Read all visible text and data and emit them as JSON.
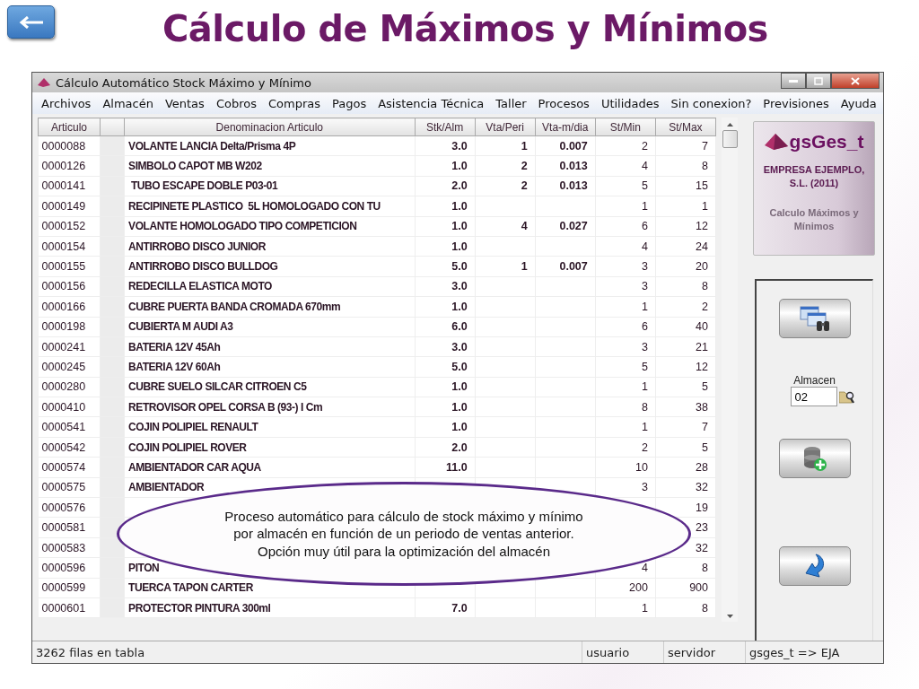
{
  "slide": {
    "title": "Cálculo de Máximos y Mínimos"
  },
  "window": {
    "title": "Cálculo Automático Stock Máximo y Mínimo",
    "menu": [
      "Archivos",
      "Almacén",
      "Ventas",
      "Cobros",
      "Compras",
      "Pagos",
      "Asistencia Técnica",
      "Taller",
      "Procesos",
      "Utilidades",
      "Sin conexion?",
      "Previsiones",
      "Ayuda"
    ],
    "table": {
      "columns": [
        "Articulo",
        "Denominacion Articulo",
        "Stk/Alm",
        "Vta/Peri",
        "Vta-m/dia",
        "St/Min",
        "St/Max"
      ],
      "rows": [
        {
          "articulo": "0000088",
          "denominacion": "VOLANTE LANCIA Delta/Prisma 4P",
          "stk_alm": "3.0",
          "vta_peri": "1",
          "vta_m_dia": "0.007",
          "st_min": "2",
          "st_max": "7"
        },
        {
          "articulo": "0000126",
          "denominacion": "SIMBOLO CAPOT MB W202",
          "stk_alm": "1.0",
          "vta_peri": "2",
          "vta_m_dia": "0.013",
          "st_min": "4",
          "st_max": "8"
        },
        {
          "articulo": "0000141",
          "denominacion": " TUBO ESCAPE DOBLE P03-01",
          "stk_alm": "2.0",
          "vta_peri": "2",
          "vta_m_dia": "0.013",
          "st_min": "5",
          "st_max": "15"
        },
        {
          "articulo": "0000149",
          "denominacion": "RECIPINETE PLASTICO  5L HOMOLOGADO CON TU",
          "stk_alm": "1.0",
          "st_min": "1",
          "st_max": "1"
        },
        {
          "articulo": "0000152",
          "denominacion": "VOLANTE HOMOLOGADO TIPO COMPETICION",
          "stk_alm": "1.0",
          "vta_peri": "4",
          "vta_m_dia": "0.027",
          "st_min": "6",
          "st_max": "12"
        },
        {
          "articulo": "0000154",
          "denominacion": "ANTIRROBO DISCO JUNIOR",
          "stk_alm": "1.0",
          "st_min": "4",
          "st_max": "24"
        },
        {
          "articulo": "0000155",
          "denominacion": "ANTIRROBO DISCO BULLDOG",
          "stk_alm": "5.0",
          "vta_peri": "1",
          "vta_m_dia": "0.007",
          "st_min": "3",
          "st_max": "20"
        },
        {
          "articulo": "0000156",
          "denominacion": "REDECILLA ELASTICA MOTO",
          "stk_alm": "3.0",
          "st_min": "3",
          "st_max": "8"
        },
        {
          "articulo": "0000166",
          "denominacion": "CUBRE PUERTA BANDA CROMADA 670mm",
          "stk_alm": "1.0",
          "st_min": "1",
          "st_max": "2"
        },
        {
          "articulo": "0000198",
          "denominacion": "CUBIERTA M AUDI A3",
          "stk_alm": "6.0",
          "st_min": "6",
          "st_max": "40"
        },
        {
          "articulo": "0000241",
          "denominacion": "BATERIA 12V 45Ah",
          "stk_alm": "3.0",
          "st_min": "3",
          "st_max": "21"
        },
        {
          "articulo": "0000245",
          "denominacion": "BATERIA 12V 60Ah",
          "stk_alm": "5.0",
          "st_min": "5",
          "st_max": "12"
        },
        {
          "articulo": "0000280",
          "denominacion": "CUBRE SUELO SILCAR CITROEN C5",
          "stk_alm": "1.0",
          "st_min": "1",
          "st_max": "5"
        },
        {
          "articulo": "0000410",
          "denominacion": "RETROVISOR OPEL CORSA B (93-) I Cm",
          "stk_alm": "1.0",
          "st_min": "8",
          "st_max": "38"
        },
        {
          "articulo": "0000541",
          "denominacion": "COJIN POLIPIEL RENAULT",
          "stk_alm": "1.0",
          "st_min": "1",
          "st_max": "7"
        },
        {
          "articulo": "0000542",
          "denominacion": "COJIN POLIPIEL ROVER",
          "stk_alm": "2.0",
          "st_min": "2",
          "st_max": "5"
        },
        {
          "articulo": "0000574",
          "denominacion": "AMBIENTADOR CAR AQUA",
          "stk_alm": "11.0",
          "st_min": "10",
          "st_max": "28"
        },
        {
          "articulo": "0000575",
          "denominacion": "AMBIENTADOR",
          "st_min": "3",
          "st_max": "32"
        },
        {
          "articulo": "0000576",
          "st_max": "19"
        },
        {
          "articulo": "0000581",
          "st_max": "23"
        },
        {
          "articulo": "0000583",
          "st_max": "32"
        },
        {
          "articulo": "0000596",
          "denominacion": "PITON",
          "st_min": "4",
          "st_max": "8"
        },
        {
          "articulo": "0000599",
          "denominacion": "TUERCA TAPON CARTER",
          "st_min": "200",
          "st_max": "900"
        },
        {
          "articulo": "0000601",
          "denominacion": "PROTECTOR PINTURA 300ml",
          "stk_alm": "7.0",
          "st_min": "1",
          "st_max": "8"
        }
      ]
    },
    "side_panel": {
      "logo_text": "gsGes_t",
      "company": "EMPRESA EJEMPLO, S.L. (2011)",
      "caption": "Calculo Máximos y Mínimos",
      "warehouse_label": "Almacen",
      "warehouse_value": "02"
    },
    "status_bar": [
      "3262 filas en tabla",
      "usuario",
      "servidor",
      "gsges_t => EJA"
    ]
  },
  "callout": {
    "text": "Proceso automático para cálculo de stock máximo y mínimo por almacén en función de un periodo de ventas anterior. Opción muy útil para la optimización del almacén"
  }
}
